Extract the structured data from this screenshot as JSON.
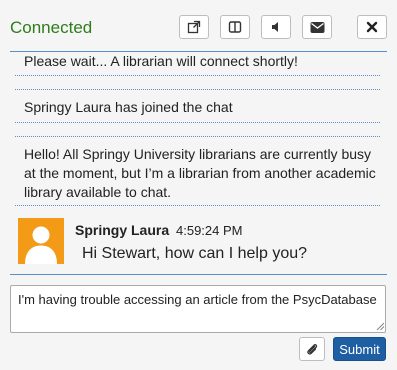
{
  "header": {
    "status": "Connected",
    "buttons": [
      {
        "icon": "external-link-icon"
      },
      {
        "icon": "split-panel-icon"
      },
      {
        "icon": "speaker-icon"
      },
      {
        "icon": "envelope-icon"
      },
      {
        "icon": "close-icon"
      }
    ]
  },
  "messages": {
    "system_wait": "Please wait... A librarian will connect shortly!",
    "system_joined": "Springy Laura has joined the chat",
    "system_busy": "Hello! All Springy University librarians are currently busy at the moment, but I’m a librarian from another academic library available to chat."
  },
  "chat": {
    "sender": "Springy Laura",
    "time": "4:59:24 PM",
    "text": "Hi Stewart, how can I help you?"
  },
  "compose": {
    "value": "I'm having trouble accessing an article from the PsycDatabase",
    "attach_icon": "paperclip-icon",
    "submit_label": "Submit"
  },
  "colors": {
    "connected": "#2e7d1b",
    "accent": "#5b8fc9",
    "avatar": "#f39b16",
    "submit": "#1e5fa3"
  }
}
